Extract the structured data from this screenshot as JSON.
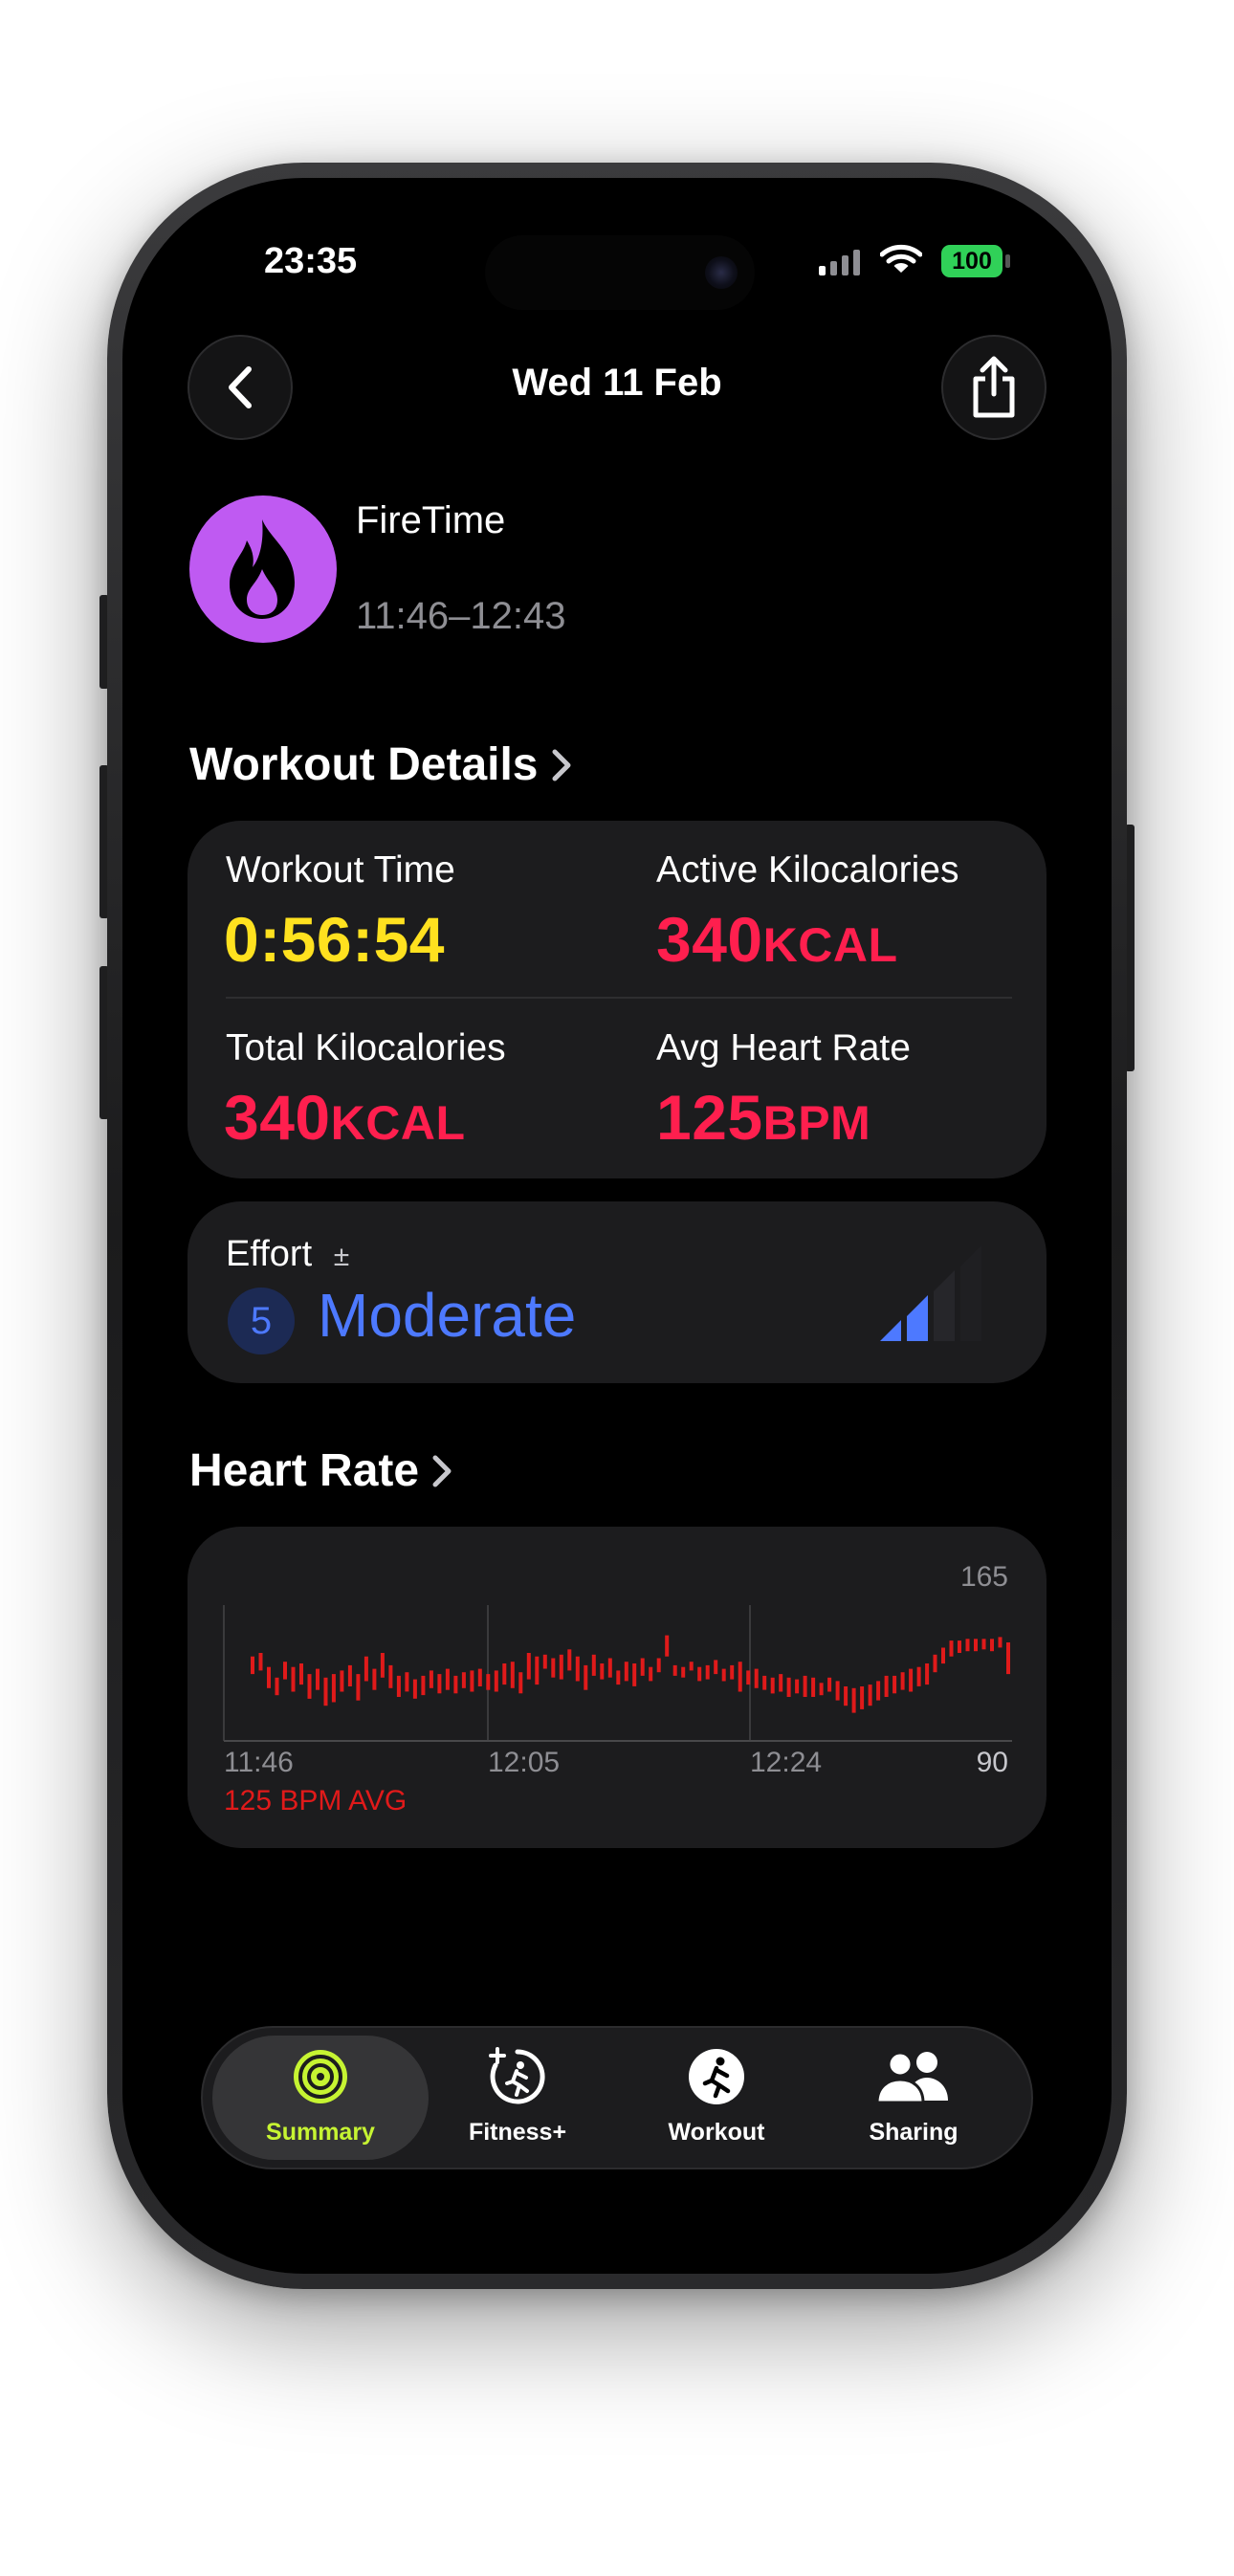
{
  "status_bar": {
    "time": "23:35",
    "battery": "100"
  },
  "nav": {
    "title": "Wed 11 Feb",
    "back_icon": "chevron-left-icon",
    "share_icon": "share-icon"
  },
  "workout": {
    "name": "FireTime",
    "time_range": "11:46–12:43",
    "icon": "flame-icon",
    "icon_color": "#bf5af2"
  },
  "details": {
    "title": "Workout Details",
    "metrics": [
      {
        "label": "Workout Time",
        "value": "0:56:54",
        "unit": "",
        "color": "#ffe11f"
      },
      {
        "label": "Active Kilocalories",
        "value": "340",
        "unit": "KCAL",
        "color": "#ff1f4e"
      },
      {
        "label": "Total Kilocalories",
        "value": "340",
        "unit": "KCAL",
        "color": "#ff1f4e"
      },
      {
        "label": "Avg Heart Rate",
        "value": "125",
        "unit": "BPM",
        "color": "#ff1f4e"
      }
    ]
  },
  "effort": {
    "label": "Effort",
    "adjust_symbol": "±",
    "level": "5",
    "word": "Moderate",
    "color": "#4d79ff",
    "bars_filled": 2,
    "bars_total": 4
  },
  "heart_rate": {
    "title": "Heart Rate"
  },
  "chart_data": {
    "type": "bar",
    "title": "",
    "x_tick_labels": [
      "11:46",
      "12:05",
      "12:24"
    ],
    "y_max_label": "165",
    "y_min_label": "90",
    "ylim": [
      90,
      165
    ],
    "avg_label": "125 BPM AVG",
    "grid": true,
    "series": [
      {
        "color": "#e01a1a",
        "ranges": [
          [
            128,
            138
          ],
          [
            130,
            140
          ],
          [
            120,
            132
          ],
          [
            116,
            126
          ],
          [
            125,
            135
          ],
          [
            118,
            132
          ],
          [
            122,
            134
          ],
          [
            114,
            128
          ],
          [
            119,
            131
          ],
          [
            110,
            126
          ],
          [
            112,
            128
          ],
          [
            118,
            130
          ],
          [
            121,
            133
          ],
          [
            113,
            128
          ],
          [
            124,
            138
          ],
          [
            119,
            131
          ],
          [
            126,
            140
          ],
          [
            120,
            133
          ],
          [
            115,
            127
          ],
          [
            118,
            129
          ],
          [
            114,
            125
          ],
          [
            116,
            127
          ],
          [
            120,
            130
          ],
          [
            117,
            128
          ],
          [
            119,
            131
          ],
          [
            117,
            127
          ],
          [
            120,
            129
          ],
          [
            118,
            130
          ],
          [
            121,
            131
          ],
          [
            119,
            128
          ],
          [
            118,
            130
          ],
          [
            122,
            134
          ],
          [
            120,
            135
          ],
          [
            117,
            129
          ],
          [
            125,
            140
          ],
          [
            122,
            138
          ],
          [
            131,
            139
          ],
          [
            126,
            137
          ],
          [
            125,
            139
          ],
          [
            130,
            142
          ],
          [
            124,
            138
          ],
          [
            119,
            133
          ],
          [
            127,
            139
          ],
          [
            125,
            134
          ],
          [
            126,
            137
          ],
          [
            122,
            130
          ],
          [
            124,
            135
          ],
          [
            121,
            134
          ],
          [
            127,
            137
          ],
          [
            124,
            132
          ],
          [
            129,
            137
          ],
          [
            138,
            150
          ],
          [
            127,
            133
          ],
          [
            126,
            132
          ],
          [
            130,
            135
          ],
          [
            124,
            132
          ],
          [
            125,
            133
          ],
          [
            128,
            136
          ],
          [
            124,
            131
          ],
          [
            125,
            133
          ],
          [
            118,
            135
          ],
          [
            122,
            130
          ],
          [
            120,
            131
          ],
          [
            119,
            127
          ],
          [
            117,
            126
          ],
          [
            118,
            128
          ],
          [
            115,
            126
          ],
          [
            117,
            125
          ],
          [
            115,
            127
          ],
          [
            115,
            126
          ],
          [
            116,
            123
          ],
          [
            118,
            126
          ],
          [
            113,
            124
          ],
          [
            110,
            121
          ],
          [
            106,
            120
          ],
          [
            108,
            121
          ],
          [
            110,
            122
          ],
          [
            113,
            124
          ],
          [
            115,
            127
          ],
          [
            117,
            127
          ],
          [
            119,
            129
          ],
          [
            118,
            131
          ],
          [
            121,
            132
          ],
          [
            122,
            134
          ],
          [
            129,
            139
          ],
          [
            134,
            143
          ],
          [
            138,
            147
          ],
          [
            140,
            147
          ],
          [
            141,
            148
          ],
          [
            141,
            148
          ],
          [
            142,
            148
          ],
          [
            141,
            148
          ],
          [
            143,
            149
          ],
          [
            128,
            146
          ]
        ]
      }
    ]
  },
  "tabs": [
    {
      "label": "Summary",
      "icon": "activity-rings-icon",
      "active": true
    },
    {
      "label": "Fitness+",
      "icon": "fitness-plus-icon",
      "active": false
    },
    {
      "label": "Workout",
      "icon": "running-figure-icon",
      "active": false
    },
    {
      "label": "Sharing",
      "icon": "people-icon",
      "active": false
    }
  ]
}
